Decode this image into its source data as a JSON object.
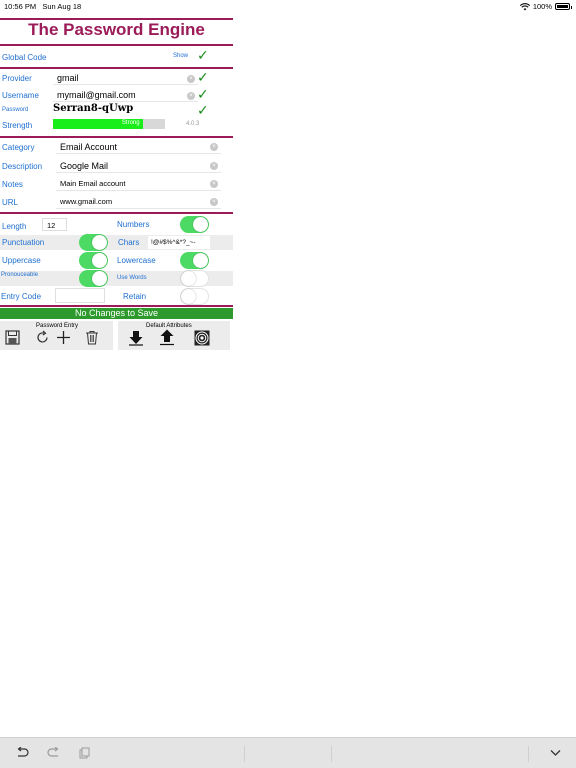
{
  "status": {
    "time": "10:56 PM",
    "date": "Sun Aug 18",
    "battery": "100%"
  },
  "app": {
    "title": "The Password Engine"
  },
  "global": {
    "label": "Global Code",
    "show_label": "Show"
  },
  "entry": {
    "provider_label": "Provider",
    "provider_value": "gmail",
    "username_label": "Username",
    "username_value": "mymail@gmail.com",
    "password_label": "Password",
    "password_value": "Serran8-qUwp",
    "strength_label": "Strength",
    "strength_text": "Strong",
    "strength_fraction": 0.8,
    "version": "4.0.3"
  },
  "details": {
    "category_label": "Category",
    "category_value": "Email Account",
    "description_label": "Description",
    "description_value": "Google Mail",
    "notes_label": "Notes",
    "notes_value": "Main Email account",
    "url_label": "URL",
    "url_value": "www.gmail.com"
  },
  "options": {
    "length_label": "Length",
    "length_value": "12",
    "numbers_label": "Numbers",
    "numbers_on": true,
    "punctuation_label": "Punctuation",
    "punctuation_on": true,
    "chars_label": "Chars",
    "chars_value": "!@#$%^&*?_~-",
    "uppercase_label": "Uppercase",
    "uppercase_on": true,
    "lowercase_label": "Lowercase",
    "lowercase_on": true,
    "pronounceable_label": "Pronouceable",
    "pronounceable_on": true,
    "usewords_label": "Use Words",
    "usewords_on": false,
    "entrycode_label": "Entry Code",
    "entrycode_value": "",
    "retain_label": "Retain",
    "retain_on": false
  },
  "save_status": "No Changes to Save",
  "toolbox": {
    "password_entry_label": "Password Entry",
    "default_attributes_label": "Default Attributes"
  },
  "colors": {
    "title": "#9b1b58",
    "label": "#1f6fd1",
    "toggle_on": "#4cd964",
    "save_bar": "#2e9a2e",
    "strength_bar": "#1aee1a"
  }
}
